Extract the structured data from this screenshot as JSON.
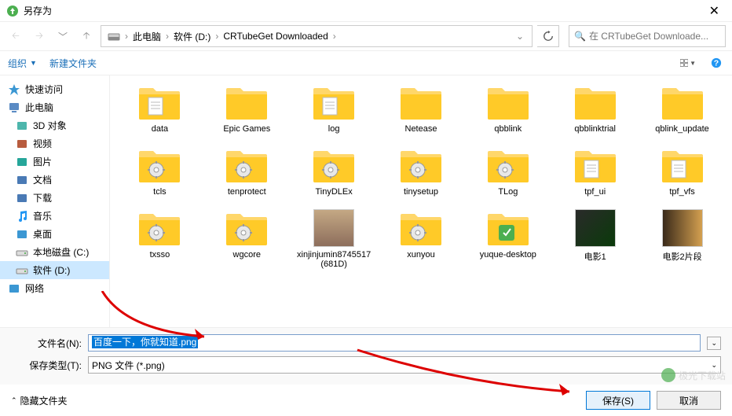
{
  "window": {
    "title": "另存为",
    "close": "✕"
  },
  "nav": {
    "breadcrumb": [
      "此电脑",
      "软件 (D:)",
      "CRTubeGet Downloaded"
    ],
    "search_placeholder": "在 CRTubeGet Downloade..."
  },
  "toolbar": {
    "organize": "组织",
    "new_folder": "新建文件夹"
  },
  "sidebar": [
    {
      "label": "快速访问",
      "icon": "quick",
      "top": true
    },
    {
      "label": "此电脑",
      "icon": "pc",
      "top": true
    },
    {
      "label": "3D 对象",
      "icon": "3d"
    },
    {
      "label": "视频",
      "icon": "video"
    },
    {
      "label": "图片",
      "icon": "pic"
    },
    {
      "label": "文档",
      "icon": "doc"
    },
    {
      "label": "下载",
      "icon": "dl"
    },
    {
      "label": "音乐",
      "icon": "music"
    },
    {
      "label": "桌面",
      "icon": "desk"
    },
    {
      "label": "本地磁盘 (C:)",
      "icon": "drive"
    },
    {
      "label": "软件 (D:)",
      "icon": "drive",
      "selected": true
    },
    {
      "label": "网络",
      "icon": "net",
      "top": true
    }
  ],
  "items": [
    {
      "label": "data",
      "type": "folder-doc"
    },
    {
      "label": "Epic Games",
      "type": "folder"
    },
    {
      "label": "log",
      "type": "folder-doc"
    },
    {
      "label": "Netease",
      "type": "folder"
    },
    {
      "label": "qbblink",
      "type": "folder"
    },
    {
      "label": "qbblinktrial",
      "type": "folder"
    },
    {
      "label": "qblink_update",
      "type": "folder"
    },
    {
      "label": "tcls",
      "type": "folder-gear"
    },
    {
      "label": "tenprotect",
      "type": "folder-gear"
    },
    {
      "label": "TinyDLEx",
      "type": "folder-gear"
    },
    {
      "label": "tinysetup",
      "type": "folder-gear"
    },
    {
      "label": "TLog",
      "type": "folder-gear"
    },
    {
      "label": "tpf_ui",
      "type": "folder-doc"
    },
    {
      "label": "tpf_vfs",
      "type": "folder-doc"
    },
    {
      "label": "txsso",
      "type": "folder-gear"
    },
    {
      "label": "wgcore",
      "type": "folder-gear"
    },
    {
      "label": "xinjinjumin8745517(681D)",
      "type": "photo"
    },
    {
      "label": "xunyou",
      "type": "folder-gear"
    },
    {
      "label": "yuque-desktop",
      "type": "folder-green"
    },
    {
      "label": "电影1",
      "type": "movie1"
    },
    {
      "label": "电影2片段",
      "type": "movie2"
    }
  ],
  "filename": {
    "label": "文件名(N):",
    "value": "百度一下，你就知道.png"
  },
  "filetype": {
    "label": "保存类型(T):",
    "value": "PNG 文件 (*.png)"
  },
  "footer": {
    "hide": "隐藏文件夹",
    "save": "保存(S)",
    "cancel": "取消"
  },
  "watermark": "极光下载站"
}
